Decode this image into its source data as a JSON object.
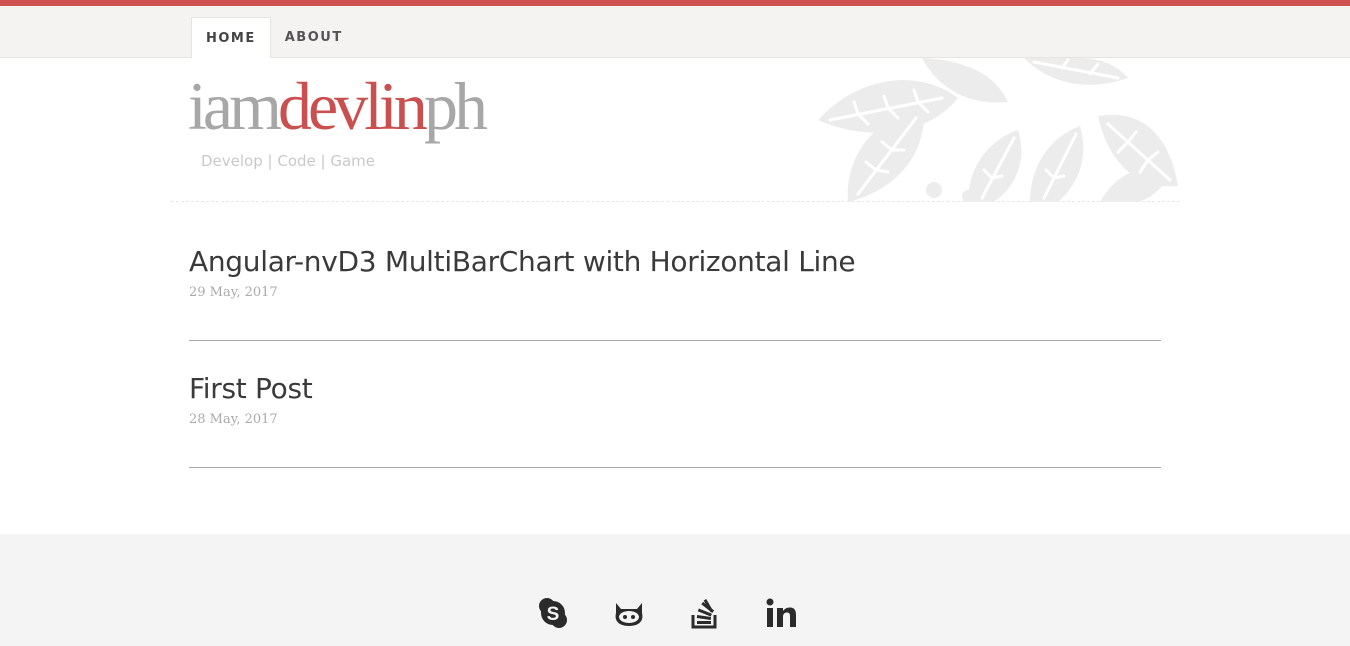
{
  "nav": {
    "items": [
      {
        "label": "HOME",
        "active": true
      },
      {
        "label": "ABOUT",
        "active": false
      }
    ]
  },
  "site": {
    "title_prefix": "iam",
    "title_highlight": "devlin",
    "title_suffix": "ph",
    "tagline": "Develop | Code | Game"
  },
  "posts": [
    {
      "title": "Angular-nvD3 MultiBarChart with Horizontal Line",
      "date": "29 May, 2017"
    },
    {
      "title": "First Post",
      "date": "28 May, 2017"
    }
  ],
  "footer": {
    "social": [
      "skype-icon",
      "github-icon",
      "stackoverflow-icon",
      "linkedin-icon"
    ]
  },
  "colors": {
    "accent": "#d05151",
    "title_gray": "#a7a7a7",
    "nav_bg": "#f4f3f1",
    "footer_bg": "#f4f4f4"
  }
}
